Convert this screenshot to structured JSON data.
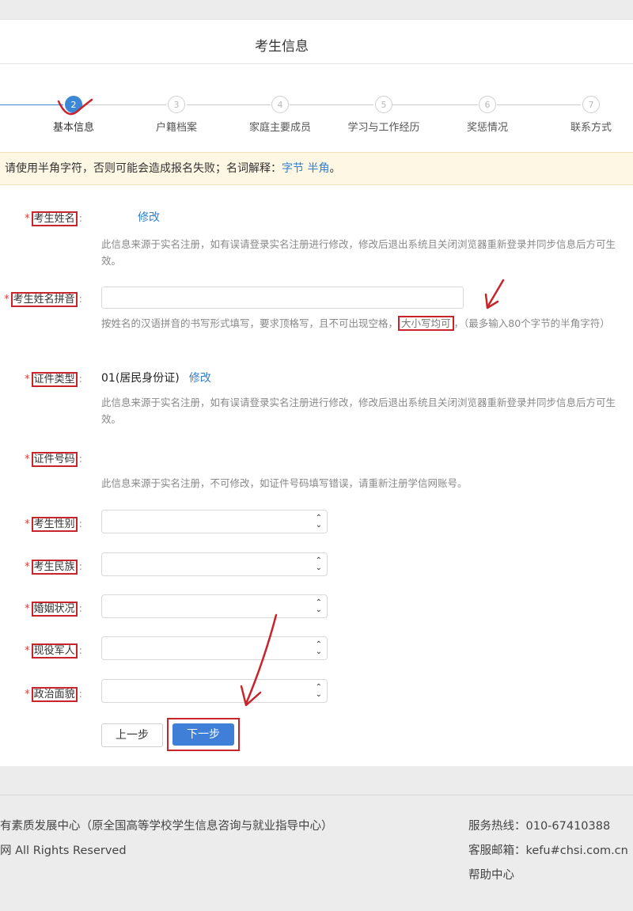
{
  "page": {
    "title": "考生信息"
  },
  "steps": [
    {
      "number": "2",
      "label": "基本信息",
      "active": true
    },
    {
      "number": "3",
      "label": "户籍档案",
      "active": false
    },
    {
      "number": "4",
      "label": "家庭主要成员",
      "active": false
    },
    {
      "number": "5",
      "label": "学习与工作经历",
      "active": false
    },
    {
      "number": "6",
      "label": "奖惩情况",
      "active": false
    },
    {
      "number": "7",
      "label": "联系方式",
      "active": false
    }
  ],
  "notice": {
    "text": "请使用半角字符，否则可能会造成报名失败；名词解释：",
    "link1": "字节",
    "link2": "半角",
    "end": "。"
  },
  "form": {
    "required_mark": "*",
    "colon": ":",
    "name": {
      "label": "考生姓名",
      "edit": "修改",
      "hint": "此信息来源于实名注册，如有误请登录实名注册进行修改，修改后退出系统且关闭浏览器重新登录并同步信息后方可生效。"
    },
    "pinyin": {
      "label": "考生姓名拼音",
      "value": "",
      "hint_before": "按姓名的汉语拼音的书写形式填写，要求顶格写，且不可出现空格，",
      "hint_highlight": "大小写均可",
      "hint_after": "，（最多输入80个字节的半角字符）"
    },
    "id_type": {
      "label": "证件类型",
      "value": "01(居民身份证)",
      "edit": "修改",
      "hint": "此信息来源于实名注册，如有误请登录实名注册进行修改，修改后退出系统且关闭浏览器重新登录并同步信息后方可生效。"
    },
    "id_number": {
      "label": "证件号码",
      "hint": "此信息来源于实名注册，不可修改，如证件号码填写错误，请重新注册学信网账号。"
    },
    "selects": [
      {
        "key": "gender",
        "label": "考生性别",
        "value": ""
      },
      {
        "key": "ethnicity",
        "label": "考生民族",
        "value": ""
      },
      {
        "key": "marital",
        "label": "婚姻状况",
        "value": ""
      },
      {
        "key": "military",
        "label": "现役军人",
        "value": ""
      },
      {
        "key": "political",
        "label": "政治面貌",
        "value": ""
      }
    ]
  },
  "buttons": {
    "prev": "上一步",
    "next": "下一步"
  },
  "footer": {
    "org": "有素质发展中心（原全国高等学校学生信息咨询与就业指导中心）",
    "rights": "网 All Rights Reserved",
    "hotline": "服务热线：010-67410388",
    "email": "客服邮箱：kefu#chsi.com.cn",
    "help": "帮助中心"
  },
  "colors": {
    "accent": "#3c88d6",
    "annotation": "#c8242c",
    "required": "#e03c3c"
  },
  "icons": {
    "select_arrow": "chevron-up-down-icon"
  }
}
